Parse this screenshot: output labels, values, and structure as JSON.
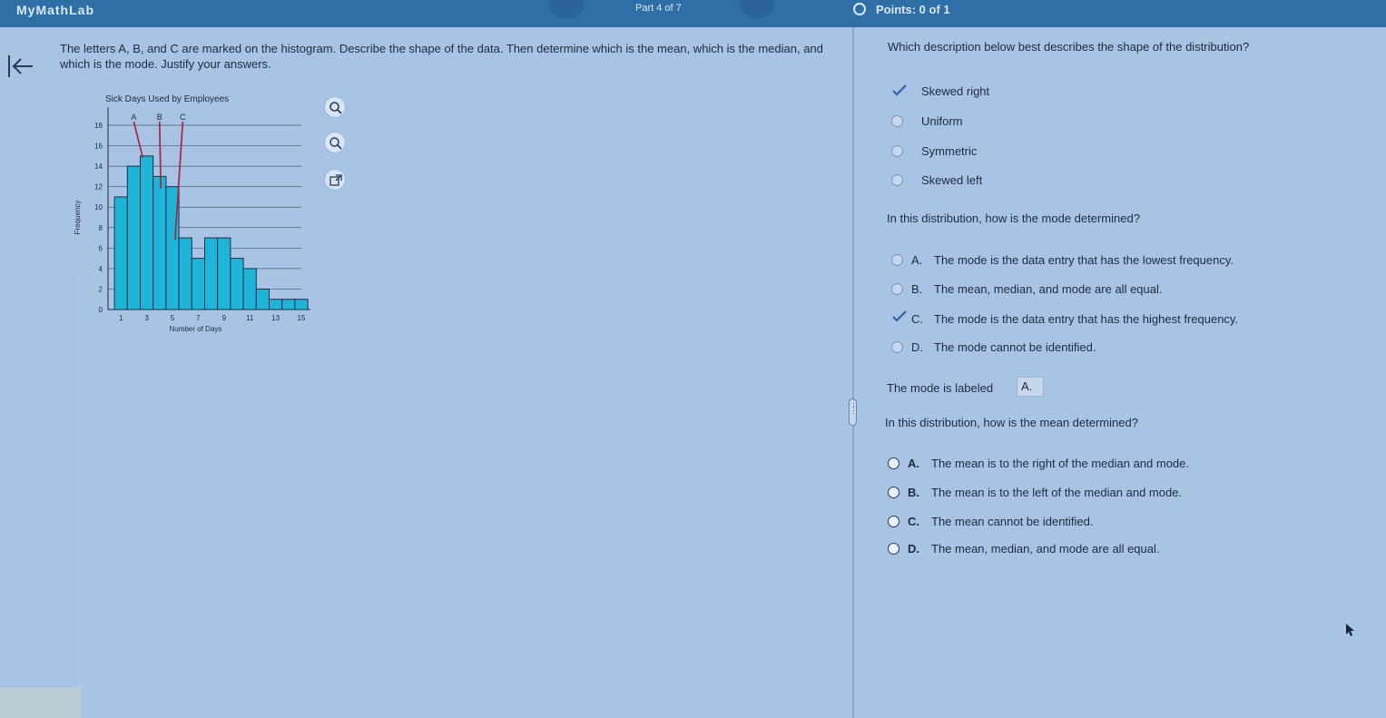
{
  "header": {
    "brand": "MyMathLab",
    "part_label": "Part 4 of 7",
    "points_label": "Points: 0 of 1"
  },
  "question": {
    "text": "The letters A, B, and C are marked on the histogram. Describe the shape of the data. Then determine which is the mean, which is the median, and which is the mode. Justify your answers."
  },
  "chart_data": {
    "type": "bar",
    "title": "Sick Days Used by Employees",
    "xlabel": "Number of Days",
    "ylabel": "Frequency",
    "ylim": [
      0,
      18
    ],
    "yticks": [
      0,
      2,
      4,
      6,
      8,
      10,
      12,
      14,
      16,
      18
    ],
    "xticks": [
      1,
      3,
      5,
      7,
      9,
      11,
      13,
      15
    ],
    "categories": [
      1,
      2,
      3,
      4,
      5,
      6,
      7,
      8,
      9,
      10,
      11,
      12,
      13,
      14,
      15
    ],
    "values": [
      11,
      14,
      15,
      13,
      12,
      7,
      5,
      7,
      7,
      5,
      4,
      2,
      1,
      1,
      1
    ],
    "bar_color": "#1fb5d9",
    "annotations": [
      {
        "label": "A",
        "x": 2.5
      },
      {
        "label": "B",
        "x": 4.5
      },
      {
        "label": "C",
        "x": 6.3
      }
    ],
    "grid": true
  },
  "shape_question": {
    "prompt": "Which description below best describes the shape of the distribution?",
    "options": [
      {
        "label": "Skewed right",
        "selected": true
      },
      {
        "label": "Uniform",
        "selected": false
      },
      {
        "label": "Symmetric",
        "selected": false
      },
      {
        "label": "Skewed left",
        "selected": false
      }
    ]
  },
  "mode_question": {
    "prompt": "In this distribution, how is the mode determined?",
    "options": [
      {
        "letter": "A.",
        "text": "The mode is the data entry that has the lowest frequency.",
        "selected": false
      },
      {
        "letter": "B.",
        "text": "The mean, median, and mode are all equal.",
        "selected": false
      },
      {
        "letter": "C.",
        "text": "The mode is the data entry that has the highest frequency.",
        "selected": true
      },
      {
        "letter": "D.",
        "text": "The mode cannot be identified.",
        "selected": false
      }
    ]
  },
  "mode_label": {
    "prefix": "The mode is labeled",
    "answer": "A."
  },
  "mean_question": {
    "prompt": "In this distribution, how is the mean determined?",
    "options": [
      {
        "letter": "A.",
        "text": "The mean is to the right of the median and mode.",
        "selected": false
      },
      {
        "letter": "B.",
        "text": "The mean is to the left of the median and mode.",
        "selected": false
      },
      {
        "letter": "C.",
        "text": "The mean cannot be identified.",
        "selected": false
      },
      {
        "letter": "D.",
        "text": "The mean, median, and mode are all equal.",
        "selected": false
      }
    ]
  },
  "colors": {
    "background": "#a9c3e4",
    "topbar": "#2f6fa6",
    "check_mark": "#2f5fa8"
  }
}
